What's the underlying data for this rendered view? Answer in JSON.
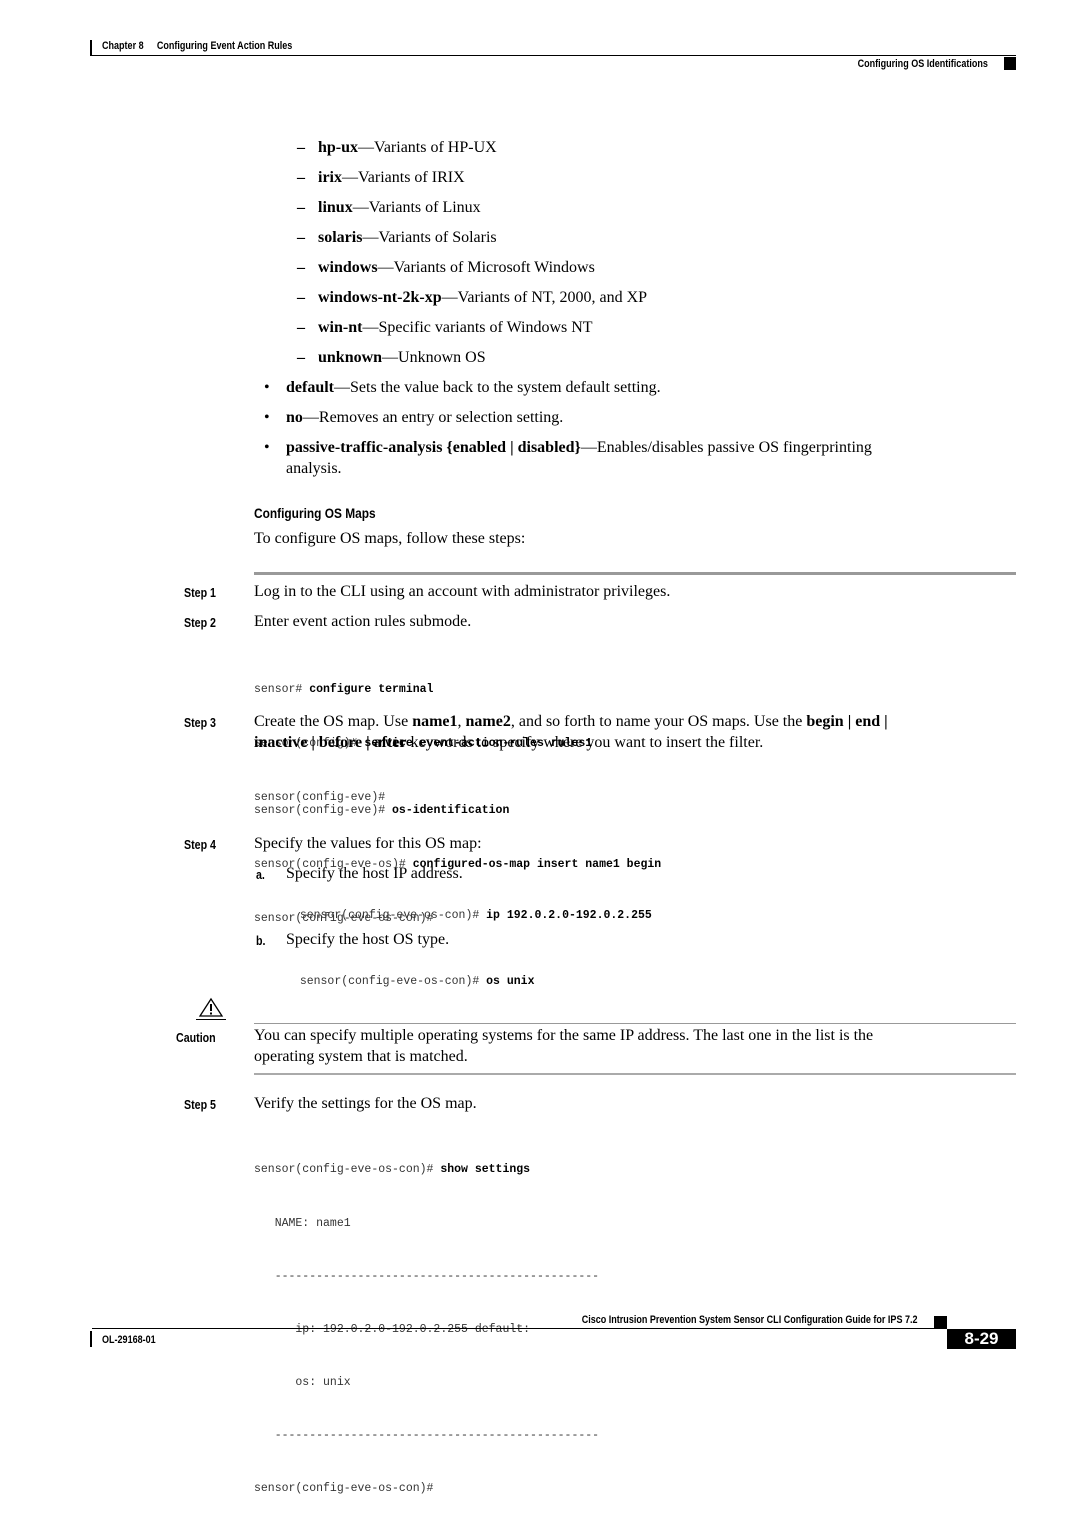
{
  "header": {
    "chapter": "Chapter 8",
    "chapter_title": "Configuring Event Action Rules",
    "section_title": "Configuring OS Identifications"
  },
  "os_variants": [
    {
      "dash": "–",
      "keyword": "hp-ux",
      "desc": "—Variants of HP-UX"
    },
    {
      "dash": "–",
      "keyword": "irix",
      "desc": "—Variants of IRIX"
    },
    {
      "dash": "–",
      "keyword": "linux",
      "desc": "—Variants of Linux"
    },
    {
      "dash": "–",
      "keyword": "solaris",
      "desc": "—Variants of Solaris"
    },
    {
      "dash": "–",
      "keyword": "windows",
      "desc": "—Variants of Microsoft Windows"
    },
    {
      "dash": "–",
      "keyword": "windows-nt-2k-xp",
      "desc": "—Variants of NT, 2000, and XP"
    },
    {
      "dash": "–",
      "keyword": "win-nt",
      "desc": "—Specific variants of Windows NT"
    },
    {
      "dash": "–",
      "keyword": "unknown",
      "desc": "—Unknown OS"
    }
  ],
  "bullets": [
    {
      "bullet": "•",
      "keyword": "default",
      "desc": "—Sets the value back to the system default setting."
    },
    {
      "bullet": "•",
      "keyword": "no",
      "desc": "—Removes an entry or selection setting."
    },
    {
      "bullet": "•",
      "keyword": "passive-traffic-analysis {enabled | disabled}",
      "desc": "—Enables/disables passive OS fingerprinting",
      "desc_line2": "analysis."
    }
  ],
  "section": {
    "title": "Configuring OS Maps",
    "intro": "To configure OS maps, follow these steps:"
  },
  "steps": [
    {
      "label": "Step 1",
      "text": "Log in to the CLI using an account with administrator privileges."
    },
    {
      "label": "Step 2",
      "text": "Enter event action rules submode.",
      "cli": [
        {
          "prompt": "sensor# ",
          "cmd": "configure terminal"
        },
        {
          "prompt": "sensor(config)# ",
          "cmd": "service event-action-rules rules1"
        },
        {
          "prompt": "sensor(config-eve)#",
          "cmd": ""
        }
      ]
    },
    {
      "label": "Step 3",
      "text_parts": [
        "Create the OS map. Use ",
        "name1",
        ", ",
        "name2",
        ", and so forth to name your OS maps. Use the ",
        "begin | end |"
      ],
      "text_line2_parts": [
        "inactive | before | after",
        " keywords to specify where you want to insert the filter."
      ],
      "cli": [
        {
          "prompt": "sensor(config-eve)# ",
          "cmd": "os-identification"
        },
        {
          "prompt": "sensor(config-eve-os)# ",
          "cmd": "configured-os-map insert name1 begin"
        },
        {
          "prompt": "sensor(config-eve-os-con)#",
          "cmd": ""
        }
      ]
    },
    {
      "label": "Step 4",
      "text": "Specify the values for this OS map:",
      "substeps": [
        {
          "label": "a.",
          "text": "Specify the host IP address.",
          "cli": {
            "prompt": "sensor(config-eve-os-con)# ",
            "cmd": "ip 192.0.2.0-192.0.2.255"
          }
        },
        {
          "label": "b.",
          "text": "Specify the host OS type.",
          "cli": {
            "prompt": "sensor(config-eve-os-con)# ",
            "cmd": "os unix"
          }
        }
      ]
    },
    {
      "label": "Step 5",
      "text": "Verify the settings for the OS map.",
      "cli_prompt": "sensor(config-eve-os-con)# ",
      "cli_cmd": "show settings",
      "output": [
        "   NAME: name1",
        "   -----------------------------------------------",
        "      ip: 192.0.2.0-192.0.2.255 default:",
        "      os: unix",
        "   -----------------------------------------------",
        "sensor(config-eve-os-con)#"
      ]
    }
  ],
  "caution": {
    "icon": "warning-triangle-icon",
    "label": "Caution",
    "text_line1": "You can specify multiple operating systems for the same IP address. The last one in the list is the",
    "text_line2": "operating system that is matched."
  },
  "footer": {
    "book_title": "Cisco Intrusion Prevention System Sensor CLI Configuration Guide for IPS 7.2",
    "doc_number": "OL-29168-01",
    "page_number": "8-29"
  }
}
